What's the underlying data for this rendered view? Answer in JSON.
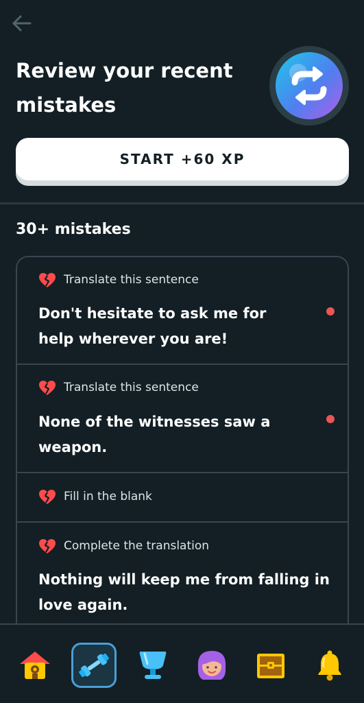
{
  "header": {
    "title": "Review your recent mistakes",
    "start_label": "START +60 XP"
  },
  "mistakes": {
    "count_label": "30+ mistakes",
    "items": [
      {
        "type": "Translate this sentence",
        "text": "Don't hesitate to ask me for help wherever you are!",
        "unread": true
      },
      {
        "type": "Translate this sentence",
        "text": "None of the witnesses saw a weapon.",
        "unread": true
      },
      {
        "type": "Fill in the blank",
        "text": "",
        "unread": false
      },
      {
        "type": "Complete the translation",
        "text": "Nothing will keep me from falling in love again.",
        "unread": false
      }
    ]
  },
  "nav": {
    "items": [
      {
        "icon": "home-icon",
        "active": false
      },
      {
        "icon": "practice-dumbbell-icon",
        "active": true
      },
      {
        "icon": "leaderboard-trophy-icon",
        "active": false
      },
      {
        "icon": "profile-avatar-icon",
        "active": false
      },
      {
        "icon": "shop-chest-icon",
        "active": false
      },
      {
        "icon": "notifications-bell-icon",
        "active": false
      }
    ]
  },
  "colors": {
    "background": "#131f24",
    "border": "#37464f",
    "heart": "#ff4b4b",
    "unread_dot": "#ea5555",
    "active_tab": "#4a9fd8"
  }
}
